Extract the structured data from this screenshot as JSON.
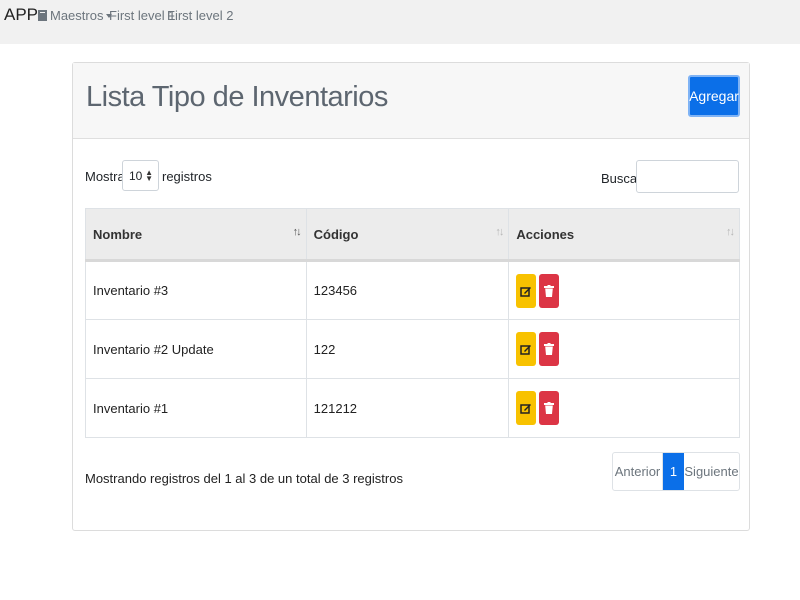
{
  "nav": {
    "brand": "APP",
    "maestros": "Maestros",
    "first_level_1": "First level 1",
    "first_level_2": "First level 2"
  },
  "header": {
    "title": "Lista Tipo de Inventarios",
    "add_label": "Agregar"
  },
  "controls": {
    "show_label": "Mostrar",
    "length_value": "10",
    "records_label": "registros",
    "search_label": "Buscar:",
    "search_value": ""
  },
  "table": {
    "columns": [
      "Nombre",
      "Código",
      "Acciones"
    ],
    "rows": [
      {
        "nombre": "Inventario #3",
        "codigo": "123456"
      },
      {
        "nombre": "Inventario #2 Update",
        "codigo": "122"
      },
      {
        "nombre": "Inventario #1",
        "codigo": "121212"
      }
    ]
  },
  "footer": {
    "info": "Mostrando registros del 1 al 3 de un total de 3 registros",
    "prev": "Anterior",
    "page": "1",
    "next": "Siguiente"
  },
  "colors": {
    "primary": "#0b6fe8",
    "warning": "#f8c200",
    "danger": "#dc3545"
  },
  "icons": {
    "edit": "edit-icon",
    "delete": "trash-icon",
    "maestros": "book-icon"
  }
}
